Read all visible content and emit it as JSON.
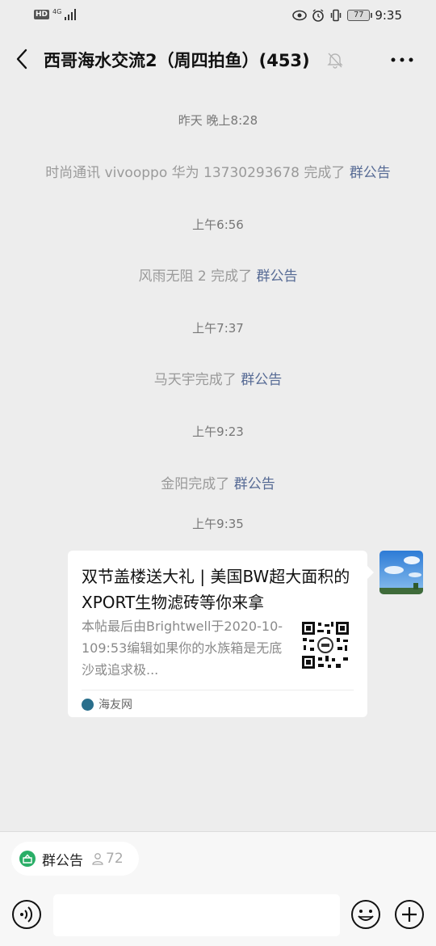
{
  "statusbar": {
    "hd": "HD",
    "network": "4G",
    "battery": "77",
    "time": "9:35"
  },
  "header": {
    "title": "西哥海水交流2（周四拍鱼）(453)"
  },
  "messages": {
    "t1": "昨天 晚上8:28",
    "m1_text": "时尚通讯 vivooppo 华为 13730293678 完成了 ",
    "m1_link": "群公告",
    "t2": "上午6:56",
    "m2_text": "风雨无阻 2 完成了 ",
    "m2_link": "群公告",
    "t3": "上午7:37",
    "m3_text": "马天宇完成了 ",
    "m3_link": "群公告",
    "t4": "上午9:23",
    "m4_text": "金阳完成了 ",
    "m4_link": "群公告",
    "t5": "上午9:35"
  },
  "card": {
    "title": "双节盖楼送大礼 | 美国BW超大面积的XPORT生物滤砖等你来拿",
    "desc": "本帖最后由Brightwell于2020-10-109:53编辑如果你的水族箱是无底沙或追求极...",
    "source": "海友网"
  },
  "bottom": {
    "notice_label": "群公告",
    "member_count": "72",
    "input_value": ""
  },
  "colors": {
    "background": "#ededed",
    "link": "#576b95",
    "notice_green": "#2aae67"
  }
}
